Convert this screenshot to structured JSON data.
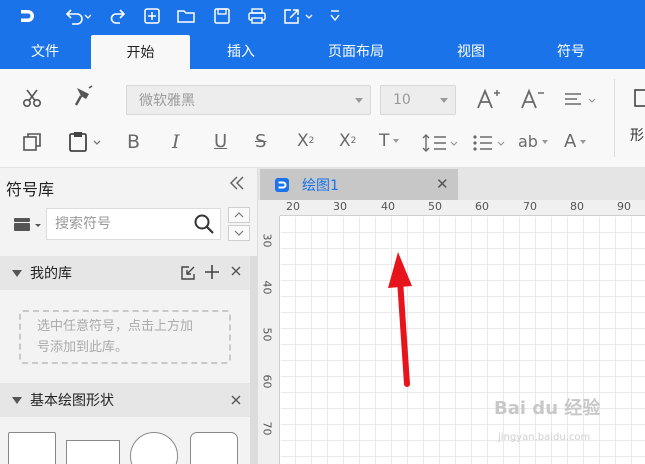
{
  "toolbar": {
    "title_icons": [
      "app-logo-icon",
      "undo-icon",
      "redo-icon",
      "new-page-icon",
      "open-folder-icon",
      "save-icon",
      "print-icon",
      "export-icon",
      "customize-icon"
    ]
  },
  "menu": {
    "tabs": [
      {
        "label": "文件"
      },
      {
        "label": "开始"
      },
      {
        "label": "插入"
      },
      {
        "label": "页面布局"
      },
      {
        "label": "视图"
      },
      {
        "label": "符号"
      }
    ],
    "active_index": 1
  },
  "ribbon": {
    "font_name": "微软雅黑",
    "font_size": "10",
    "ab_label": "ab",
    "shape_label": "形"
  },
  "library": {
    "title": "符号库",
    "search_placeholder": "搜索符号",
    "my_library": "我的库",
    "hint": "选中任意符号，点击上方加号添加到此库。",
    "hint_line1": "选中任意符号，点击上方加",
    "hint_line2": "号添加到此库。",
    "basic_shapes": "基本绘图形状"
  },
  "document": {
    "tab_name": "绘图1"
  },
  "ruler": {
    "h_labels": [
      "20",
      "30",
      "40",
      "50",
      "60",
      "70",
      "80",
      "90"
    ],
    "v_labels": [
      "30",
      "40",
      "50",
      "60",
      "70"
    ]
  },
  "watermark": {
    "text": "Bai du 经验",
    "sub": "jingyan.baidu.com"
  },
  "colors": {
    "accent": "#1a73e8",
    "arrow": "#e8141c"
  }
}
